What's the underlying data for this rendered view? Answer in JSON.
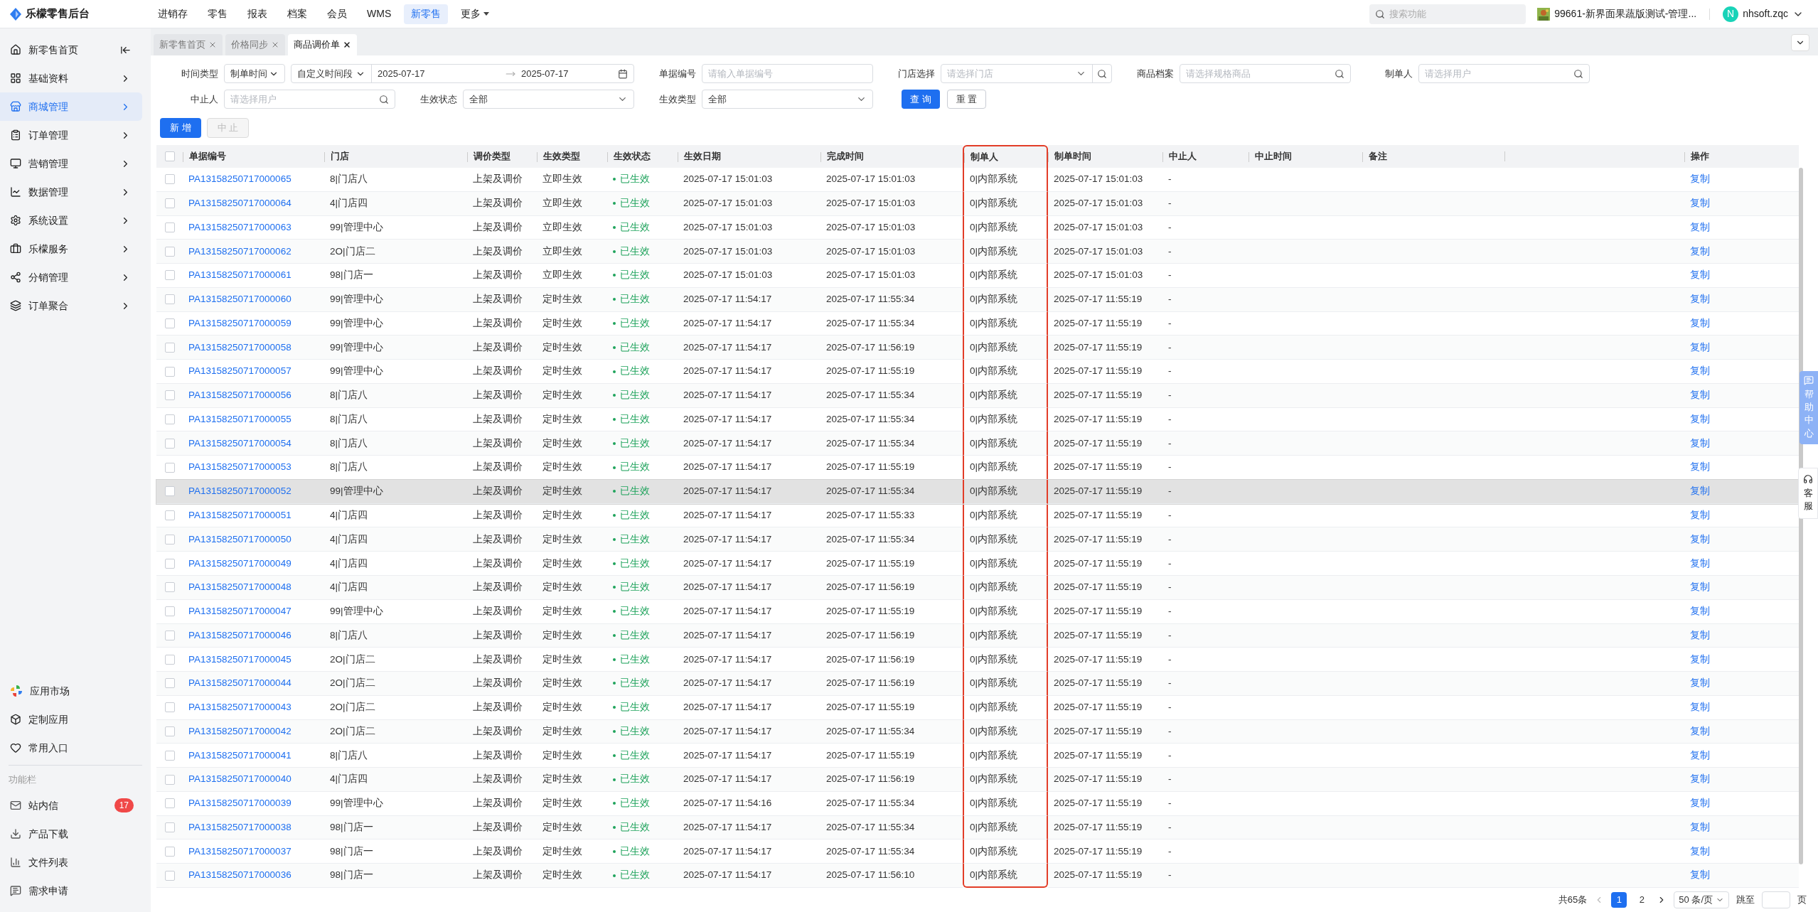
{
  "app": {
    "title": "乐檬零售后台"
  },
  "top_nav": [
    {
      "label": "进销存",
      "selected": false
    },
    {
      "label": "零售",
      "selected": false
    },
    {
      "label": "报表",
      "selected": false
    },
    {
      "label": "档案",
      "selected": false
    },
    {
      "label": "会员",
      "selected": false
    },
    {
      "label": "WMS",
      "selected": false
    },
    {
      "label": "新零售",
      "selected": true
    },
    {
      "label": "更多",
      "selected": false,
      "kind": "menu"
    }
  ],
  "search": {
    "placeholder": "搜索功能"
  },
  "store": {
    "name": "99661-新界面果蔬版测试-管理..."
  },
  "user": {
    "initial": "N",
    "name": "nhsoft.zqc"
  },
  "sidebar": {
    "items": [
      {
        "label": "新零售首页",
        "selected": false,
        "kind": "home"
      },
      {
        "label": "基础资料",
        "selected": false,
        "kind": "group"
      },
      {
        "label": "商城管理",
        "selected": true,
        "kind": "group"
      },
      {
        "label": "订单管理",
        "selected": false,
        "kind": "group"
      },
      {
        "label": "营销管理",
        "selected": false,
        "kind": "group"
      },
      {
        "label": "数据管理",
        "selected": false,
        "kind": "group"
      },
      {
        "label": "系统设置",
        "selected": false,
        "kind": "group"
      },
      {
        "label": "乐檬服务",
        "selected": false,
        "kind": "group"
      },
      {
        "label": "分销管理",
        "selected": false,
        "kind": "group"
      },
      {
        "label": "订单聚合",
        "selected": false,
        "kind": "group"
      }
    ],
    "apps": [
      {
        "label": "应用市场"
      },
      {
        "label": "定制应用"
      },
      {
        "label": "常用入口"
      }
    ],
    "section_title": "功能栏",
    "functions": [
      {
        "label": "站内信",
        "badge": "17"
      },
      {
        "label": "产品下载"
      },
      {
        "label": "文件列表"
      },
      {
        "label": "需求申请"
      }
    ]
  },
  "tabs": [
    {
      "label": "新零售首页",
      "selected": false
    },
    {
      "label": "价格同步",
      "selected": false
    },
    {
      "label": "商品调价单",
      "selected": true
    }
  ],
  "filters": [
    [
      {
        "kind": "time_range",
        "label": "时间类型",
        "type_value": "制单时间",
        "mode": "自定义时间段",
        "start": "2025-07-17",
        "end": "2025-07-17"
      },
      {
        "kind": "input",
        "label": "单据编号",
        "placeholder": "请输入单据编号"
      },
      {
        "kind": "store",
        "label": "门店选择",
        "placeholder": "请选择门店"
      },
      {
        "kind": "search",
        "label": "商品档案",
        "placeholder": "请选择规格商品"
      },
      {
        "kind": "search",
        "label": "制单人",
        "placeholder": "请选择用户"
      }
    ],
    [
      {
        "kind": "search",
        "label": "中止人",
        "placeholder": "请选择用户"
      },
      {
        "kind": "select",
        "label": "生效状态",
        "value": "全部"
      },
      {
        "kind": "select",
        "label": "生效类型",
        "value": "全部"
      },
      {
        "kind": "buttons",
        "buttons": [
          {
            "label": "查 询",
            "kind": "primary"
          },
          {
            "label": "重 置",
            "kind": "default"
          }
        ]
      }
    ]
  ],
  "actions": [
    {
      "label": "新 增",
      "disabled": false
    },
    {
      "label": "中 止",
      "disabled": true
    }
  ],
  "table": {
    "all_checked": false,
    "columns": [
      {
        "label": "单据编号",
        "highlighted": false
      },
      {
        "label": "门店",
        "highlighted": false
      },
      {
        "label": "调价类型",
        "highlighted": false
      },
      {
        "label": "生效类型",
        "highlighted": false
      },
      {
        "label": "生效状态",
        "highlighted": false
      },
      {
        "label": "生效日期",
        "highlighted": false
      },
      {
        "label": "完成时间",
        "highlighted": false
      },
      {
        "label": "制单人",
        "highlighted": true
      },
      {
        "label": "制单时间",
        "highlighted": false
      },
      {
        "label": "中止人",
        "highlighted": false
      },
      {
        "label": "中止时间",
        "highlighted": false
      },
      {
        "label": "备注",
        "highlighted": false
      },
      {
        "label": "操作",
        "highlighted": false
      }
    ],
    "rows": [
      {
        "checked": false,
        "hovered": false,
        "no": "PA13158250717000065",
        "store": "8|门店八",
        "adjust": "上架及调价",
        "effect": "立即生效",
        "status": "已生效",
        "date": "2025-07-17 15:01:03",
        "done": "2025-07-17 15:01:03",
        "creator": "0|内部系统",
        "created": "2025-07-17 15:01:03",
        "stopper": "-",
        "action": "复制"
      },
      {
        "checked": false,
        "hovered": false,
        "no": "PA13158250717000064",
        "store": "4|门店四",
        "adjust": "上架及调价",
        "effect": "立即生效",
        "status": "已生效",
        "date": "2025-07-17 15:01:03",
        "done": "2025-07-17 15:01:03",
        "creator": "0|内部系统",
        "created": "2025-07-17 15:01:03",
        "stopper": "-",
        "action": "复制"
      },
      {
        "checked": false,
        "hovered": false,
        "no": "PA13158250717000063",
        "store": "99|管理中心",
        "adjust": "上架及调价",
        "effect": "立即生效",
        "status": "已生效",
        "date": "2025-07-17 15:01:03",
        "done": "2025-07-17 15:01:03",
        "creator": "0|内部系统",
        "created": "2025-07-17 15:01:03",
        "stopper": "-",
        "action": "复制"
      },
      {
        "checked": false,
        "hovered": false,
        "no": "PA13158250717000062",
        "store": "2O|门店二",
        "adjust": "上架及调价",
        "effect": "立即生效",
        "status": "已生效",
        "date": "2025-07-17 15:01:03",
        "done": "2025-07-17 15:01:03",
        "creator": "0|内部系统",
        "created": "2025-07-17 15:01:03",
        "stopper": "-",
        "action": "复制"
      },
      {
        "checked": false,
        "hovered": false,
        "no": "PA13158250717000061",
        "store": "98|门店一",
        "adjust": "上架及调价",
        "effect": "立即生效",
        "status": "已生效",
        "date": "2025-07-17 15:01:03",
        "done": "2025-07-17 15:01:03",
        "creator": "0|内部系统",
        "created": "2025-07-17 15:01:03",
        "stopper": "-",
        "action": "复制"
      },
      {
        "checked": false,
        "hovered": false,
        "no": "PA13158250717000060",
        "store": "99|管理中心",
        "adjust": "上架及调价",
        "effect": "定时生效",
        "status": "已生效",
        "date": "2025-07-17 11:54:17",
        "done": "2025-07-17 11:55:34",
        "creator": "0|内部系统",
        "created": "2025-07-17 11:55:19",
        "stopper": "-",
        "action": "复制"
      },
      {
        "checked": false,
        "hovered": false,
        "no": "PA13158250717000059",
        "store": "99|管理中心",
        "adjust": "上架及调价",
        "effect": "定时生效",
        "status": "已生效",
        "date": "2025-07-17 11:54:17",
        "done": "2025-07-17 11:55:34",
        "creator": "0|内部系统",
        "created": "2025-07-17 11:55:19",
        "stopper": "-",
        "action": "复制"
      },
      {
        "checked": false,
        "hovered": false,
        "no": "PA13158250717000058",
        "store": "99|管理中心",
        "adjust": "上架及调价",
        "effect": "定时生效",
        "status": "已生效",
        "date": "2025-07-17 11:54:17",
        "done": "2025-07-17 11:56:19",
        "creator": "0|内部系统",
        "created": "2025-07-17 11:55:19",
        "stopper": "-",
        "action": "复制"
      },
      {
        "checked": false,
        "hovered": false,
        "no": "PA13158250717000057",
        "store": "99|管理中心",
        "adjust": "上架及调价",
        "effect": "定时生效",
        "status": "已生效",
        "date": "2025-07-17 11:54:17",
        "done": "2025-07-17 11:55:19",
        "creator": "0|内部系统",
        "created": "2025-07-17 11:55:19",
        "stopper": "-",
        "action": "复制"
      },
      {
        "checked": false,
        "hovered": false,
        "no": "PA13158250717000056",
        "store": "8|门店八",
        "adjust": "上架及调价",
        "effect": "定时生效",
        "status": "已生效",
        "date": "2025-07-17 11:54:17",
        "done": "2025-07-17 11:55:34",
        "creator": "0|内部系统",
        "created": "2025-07-17 11:55:19",
        "stopper": "-",
        "action": "复制"
      },
      {
        "checked": false,
        "hovered": false,
        "no": "PA13158250717000055",
        "store": "8|门店八",
        "adjust": "上架及调价",
        "effect": "定时生效",
        "status": "已生效",
        "date": "2025-07-17 11:54:17",
        "done": "2025-07-17 11:55:34",
        "creator": "0|内部系统",
        "created": "2025-07-17 11:55:19",
        "stopper": "-",
        "action": "复制"
      },
      {
        "checked": false,
        "hovered": false,
        "no": "PA13158250717000054",
        "store": "8|门店八",
        "adjust": "上架及调价",
        "effect": "定时生效",
        "status": "已生效",
        "date": "2025-07-17 11:54:17",
        "done": "2025-07-17 11:55:34",
        "creator": "0|内部系统",
        "created": "2025-07-17 11:55:19",
        "stopper": "-",
        "action": "复制"
      },
      {
        "checked": false,
        "hovered": false,
        "no": "PA13158250717000053",
        "store": "8|门店八",
        "adjust": "上架及调价",
        "effect": "定时生效",
        "status": "已生效",
        "date": "2025-07-17 11:54:17",
        "done": "2025-07-17 11:55:19",
        "creator": "0|内部系统",
        "created": "2025-07-17 11:55:19",
        "stopper": "-",
        "action": "复制"
      },
      {
        "checked": false,
        "hovered": true,
        "no": "PA13158250717000052",
        "store": "99|管理中心",
        "adjust": "上架及调价",
        "effect": "定时生效",
        "status": "已生效",
        "date": "2025-07-17 11:54:17",
        "done": "2025-07-17 11:55:34",
        "creator": "0|内部系统",
        "created": "2025-07-17 11:55:19",
        "stopper": "-",
        "action": "复制"
      },
      {
        "checked": false,
        "hovered": false,
        "no": "PA13158250717000051",
        "store": "4|门店四",
        "adjust": "上架及调价",
        "effect": "定时生效",
        "status": "已生效",
        "date": "2025-07-17 11:54:17",
        "done": "2025-07-17 11:55:33",
        "creator": "0|内部系统",
        "created": "2025-07-17 11:55:19",
        "stopper": "-",
        "action": "复制"
      },
      {
        "checked": false,
        "hovered": false,
        "no": "PA13158250717000050",
        "store": "4|门店四",
        "adjust": "上架及调价",
        "effect": "定时生效",
        "status": "已生效",
        "date": "2025-07-17 11:54:17",
        "done": "2025-07-17 11:55:34",
        "creator": "0|内部系统",
        "created": "2025-07-17 11:55:19",
        "stopper": "-",
        "action": "复制"
      },
      {
        "checked": false,
        "hovered": false,
        "no": "PA13158250717000049",
        "store": "4|门店四",
        "adjust": "上架及调价",
        "effect": "定时生效",
        "status": "已生效",
        "date": "2025-07-17 11:54:17",
        "done": "2025-07-17 11:55:19",
        "creator": "0|内部系统",
        "created": "2025-07-17 11:55:19",
        "stopper": "-",
        "action": "复制"
      },
      {
        "checked": false,
        "hovered": false,
        "no": "PA13158250717000048",
        "store": "4|门店四",
        "adjust": "上架及调价",
        "effect": "定时生效",
        "status": "已生效",
        "date": "2025-07-17 11:54:17",
        "done": "2025-07-17 11:56:19",
        "creator": "0|内部系统",
        "created": "2025-07-17 11:55:19",
        "stopper": "-",
        "action": "复制"
      },
      {
        "checked": false,
        "hovered": false,
        "no": "PA13158250717000047",
        "store": "99|管理中心",
        "adjust": "上架及调价",
        "effect": "定时生效",
        "status": "已生效",
        "date": "2025-07-17 11:54:17",
        "done": "2025-07-17 11:55:19",
        "creator": "0|内部系统",
        "created": "2025-07-17 11:55:19",
        "stopper": "-",
        "action": "复制"
      },
      {
        "checked": false,
        "hovered": false,
        "no": "PA13158250717000046",
        "store": "8|门店八",
        "adjust": "上架及调价",
        "effect": "定时生效",
        "status": "已生效",
        "date": "2025-07-17 11:54:17",
        "done": "2025-07-17 11:56:19",
        "creator": "0|内部系统",
        "created": "2025-07-17 11:55:19",
        "stopper": "-",
        "action": "复制"
      },
      {
        "checked": false,
        "hovered": false,
        "no": "PA13158250717000045",
        "store": "2O|门店二",
        "adjust": "上架及调价",
        "effect": "定时生效",
        "status": "已生效",
        "date": "2025-07-17 11:54:17",
        "done": "2025-07-17 11:56:19",
        "creator": "0|内部系统",
        "created": "2025-07-17 11:55:19",
        "stopper": "-",
        "action": "复制"
      },
      {
        "checked": false,
        "hovered": false,
        "no": "PA13158250717000044",
        "store": "2O|门店二",
        "adjust": "上架及调价",
        "effect": "定时生效",
        "status": "已生效",
        "date": "2025-07-17 11:54:17",
        "done": "2025-07-17 11:56:19",
        "creator": "0|内部系统",
        "created": "2025-07-17 11:55:19",
        "stopper": "-",
        "action": "复制"
      },
      {
        "checked": false,
        "hovered": false,
        "no": "PA13158250717000043",
        "store": "2O|门店二",
        "adjust": "上架及调价",
        "effect": "定时生效",
        "status": "已生效",
        "date": "2025-07-17 11:54:17",
        "done": "2025-07-17 11:55:19",
        "creator": "0|内部系统",
        "created": "2025-07-17 11:55:19",
        "stopper": "-",
        "action": "复制"
      },
      {
        "checked": false,
        "hovered": false,
        "no": "PA13158250717000042",
        "store": "2O|门店二",
        "adjust": "上架及调价",
        "effect": "定时生效",
        "status": "已生效",
        "date": "2025-07-17 11:54:17",
        "done": "2025-07-17 11:55:34",
        "creator": "0|内部系统",
        "created": "2025-07-17 11:55:19",
        "stopper": "-",
        "action": "复制"
      },
      {
        "checked": false,
        "hovered": false,
        "no": "PA13158250717000041",
        "store": "8|门店八",
        "adjust": "上架及调价",
        "effect": "定时生效",
        "status": "已生效",
        "date": "2025-07-17 11:54:17",
        "done": "2025-07-17 11:55:19",
        "creator": "0|内部系统",
        "created": "2025-07-17 11:55:19",
        "stopper": "-",
        "action": "复制"
      },
      {
        "checked": false,
        "hovered": false,
        "no": "PA13158250717000040",
        "store": "4|门店四",
        "adjust": "上架及调价",
        "effect": "定时生效",
        "status": "已生效",
        "date": "2025-07-17 11:54:17",
        "done": "2025-07-17 11:56:19",
        "creator": "0|内部系统",
        "created": "2025-07-17 11:55:19",
        "stopper": "-",
        "action": "复制"
      },
      {
        "checked": false,
        "hovered": false,
        "no": "PA13158250717000039",
        "store": "99|管理中心",
        "adjust": "上架及调价",
        "effect": "定时生效",
        "status": "已生效",
        "date": "2025-07-17 11:54:16",
        "done": "2025-07-17 11:55:34",
        "creator": "0|内部系统",
        "created": "2025-07-17 11:55:19",
        "stopper": "-",
        "action": "复制"
      },
      {
        "checked": false,
        "hovered": false,
        "no": "PA13158250717000038",
        "store": "98|门店一",
        "adjust": "上架及调价",
        "effect": "定时生效",
        "status": "已生效",
        "date": "2025-07-17 11:54:17",
        "done": "2025-07-17 11:55:34",
        "creator": "0|内部系统",
        "created": "2025-07-17 11:55:19",
        "stopper": "-",
        "action": "复制"
      },
      {
        "checked": false,
        "hovered": false,
        "no": "PA13158250717000037",
        "store": "98|门店一",
        "adjust": "上架及调价",
        "effect": "定时生效",
        "status": "已生效",
        "date": "2025-07-17 11:54:17",
        "done": "2025-07-17 11:55:34",
        "creator": "0|内部系统",
        "created": "2025-07-17 11:55:19",
        "stopper": "-",
        "action": "复制"
      },
      {
        "checked": false,
        "hovered": false,
        "no": "PA13158250717000036",
        "store": "98|门店一",
        "adjust": "上架及调价",
        "effect": "定时生效",
        "status": "已生效",
        "date": "2025-07-17 11:54:17",
        "done": "2025-07-17 11:56:10",
        "creator": "0|内部系统",
        "created": "2025-07-17 11:55:19",
        "stopper": "-",
        "action": "复制"
      }
    ]
  },
  "pagination": {
    "total": "共65条",
    "pages": [
      {
        "label": "1",
        "selected": true
      },
      {
        "label": "2",
        "selected": false
      }
    ],
    "page_size": "50 条/页",
    "jump_label": "跳至",
    "jump_suffix": "页"
  },
  "help": {
    "label": "帮助中心",
    "service": "客服"
  }
}
